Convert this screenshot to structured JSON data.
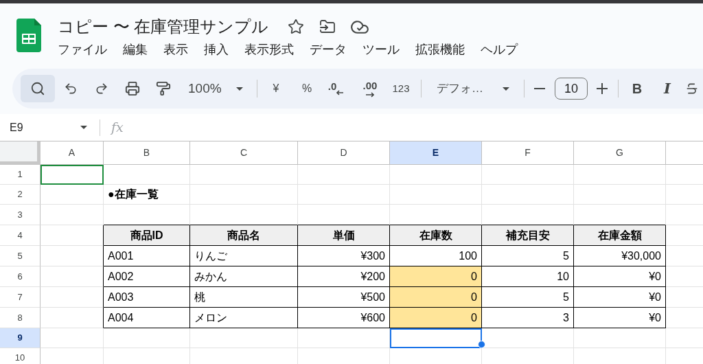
{
  "window": {
    "title": "コピー 〜 在庫管理サンプル"
  },
  "menu": [
    "ファイル",
    "編集",
    "表示",
    "挿入",
    "表示形式",
    "データ",
    "ツール",
    "拡張機能",
    "ヘルプ"
  ],
  "toolbar": {
    "search": {
      "selected": true
    },
    "zoom": "100%",
    "currency": "¥",
    "percent": "%",
    "decrease_decimal": ".0",
    "increase_decimal": ".00",
    "number_format": "123",
    "font": "デフォ…",
    "font_size": "10",
    "bold": "B",
    "italic": "I"
  },
  "formula_bar": {
    "name_box": "E9",
    "fx": "fx"
  },
  "sheet": {
    "columns": [
      {
        "label": "A",
        "selected": false
      },
      {
        "label": "B",
        "selected": false
      },
      {
        "label": "C",
        "selected": false
      },
      {
        "label": "D",
        "selected": false
      },
      {
        "label": "E",
        "selected": true
      },
      {
        "label": "F",
        "selected": false
      },
      {
        "label": "G",
        "selected": false
      }
    ],
    "rows": [
      {
        "label": "1",
        "selected": false,
        "cells": [
          {
            "kind": "cursor",
            "selected": false
          },
          {
            "kind": "empty",
            "selected": false
          },
          {
            "kind": "empty",
            "selected": false
          },
          {
            "kind": "empty",
            "selected": false
          },
          {
            "kind": "empty",
            "selected": false
          },
          {
            "kind": "empty",
            "selected": false
          },
          {
            "kind": "empty",
            "selected": false
          }
        ]
      },
      {
        "label": "2",
        "selected": false,
        "cells": [
          {
            "kind": "empty",
            "selected": false
          },
          {
            "kind": "title",
            "text": "●在庫一覧",
            "selected": false
          },
          {
            "kind": "empty",
            "selected": false
          },
          {
            "kind": "empty",
            "selected": false
          },
          {
            "kind": "empty",
            "selected": false
          },
          {
            "kind": "empty",
            "selected": false
          },
          {
            "kind": "empty",
            "selected": false
          }
        ]
      },
      {
        "label": "3",
        "selected": false,
        "cells": [
          {
            "kind": "empty",
            "selected": false
          },
          {
            "kind": "empty",
            "selected": false
          },
          {
            "kind": "empty",
            "selected": false
          },
          {
            "kind": "empty",
            "selected": false
          },
          {
            "kind": "empty",
            "selected": false
          },
          {
            "kind": "empty",
            "selected": false
          },
          {
            "kind": "empty",
            "selected": false
          }
        ]
      },
      {
        "label": "4",
        "selected": false,
        "cells": [
          {
            "kind": "empty",
            "selected": false
          },
          {
            "kind": "header",
            "text": "商品ID",
            "highlighted": false,
            "selected": false
          },
          {
            "kind": "header",
            "text": "商品名",
            "highlighted": false,
            "selected": false
          },
          {
            "kind": "header",
            "text": "単価",
            "highlighted": false,
            "selected": false
          },
          {
            "kind": "header",
            "text": "在庫数",
            "highlighted": false,
            "selected": false
          },
          {
            "kind": "header",
            "text": "補充目安",
            "highlighted": false,
            "selected": false
          },
          {
            "kind": "header",
            "text": "在庫金額",
            "highlighted": false,
            "selected": false
          }
        ]
      },
      {
        "label": "5",
        "selected": false,
        "cells": [
          {
            "kind": "empty",
            "selected": false
          },
          {
            "kind": "text",
            "text": "A001",
            "highlighted": false,
            "selected": false
          },
          {
            "kind": "text",
            "text": "りんご",
            "highlighted": false,
            "selected": false
          },
          {
            "kind": "number",
            "text": "¥300",
            "highlighted": false,
            "selected": false
          },
          {
            "kind": "number",
            "text": "100",
            "highlighted": false,
            "selected": false
          },
          {
            "kind": "number",
            "text": "5",
            "highlighted": false,
            "selected": false
          },
          {
            "kind": "number",
            "text": "¥30,000",
            "highlighted": false,
            "selected": false
          }
        ]
      },
      {
        "label": "6",
        "selected": false,
        "cells": [
          {
            "kind": "empty",
            "selected": false
          },
          {
            "kind": "text",
            "text": "A002",
            "highlighted": false,
            "selected": false
          },
          {
            "kind": "text",
            "text": "みかん",
            "highlighted": false,
            "selected": false
          },
          {
            "kind": "number",
            "text": "¥200",
            "highlighted": false,
            "selected": false
          },
          {
            "kind": "number",
            "text": "0",
            "highlighted": true,
            "selected": false
          },
          {
            "kind": "number",
            "text": "10",
            "highlighted": false,
            "selected": false
          },
          {
            "kind": "number",
            "text": "¥0",
            "highlighted": false,
            "selected": false
          }
        ]
      },
      {
        "label": "7",
        "selected": false,
        "cells": [
          {
            "kind": "empty",
            "selected": false
          },
          {
            "kind": "text",
            "text": "A003",
            "highlighted": false,
            "selected": false
          },
          {
            "kind": "text",
            "text": "桃",
            "highlighted": false,
            "selected": false
          },
          {
            "kind": "number",
            "text": "¥500",
            "highlighted": false,
            "selected": false
          },
          {
            "kind": "number",
            "text": "0",
            "highlighted": true,
            "selected": false
          },
          {
            "kind": "number",
            "text": "5",
            "highlighted": false,
            "selected": false
          },
          {
            "kind": "number",
            "text": "¥0",
            "highlighted": false,
            "selected": false
          }
        ]
      },
      {
        "label": "8",
        "selected": false,
        "cells": [
          {
            "kind": "empty",
            "selected": false
          },
          {
            "kind": "text",
            "text": "A004",
            "highlighted": false,
            "selected": false
          },
          {
            "kind": "text",
            "text": "メロン",
            "highlighted": false,
            "selected": false
          },
          {
            "kind": "number",
            "text": "¥600",
            "highlighted": false,
            "selected": false
          },
          {
            "kind": "number",
            "text": "0",
            "highlighted": true,
            "selected": false
          },
          {
            "kind": "number",
            "text": "3",
            "highlighted": false,
            "selected": false
          },
          {
            "kind": "number",
            "text": "¥0",
            "highlighted": false,
            "selected": false
          }
        ]
      },
      {
        "label": "9",
        "selected": true,
        "cells": [
          {
            "kind": "empty",
            "selected": false
          },
          {
            "kind": "empty",
            "selected": false
          },
          {
            "kind": "empty",
            "selected": false
          },
          {
            "kind": "empty",
            "selected": false
          },
          {
            "kind": "empty",
            "selected": true
          },
          {
            "kind": "empty",
            "selected": false
          },
          {
            "kind": "empty",
            "selected": false
          }
        ]
      },
      {
        "label": "10",
        "selected": false,
        "cells": [
          {
            "kind": "empty",
            "selected": false
          },
          {
            "kind": "empty",
            "selected": false
          },
          {
            "kind": "empty",
            "selected": false
          },
          {
            "kind": "empty",
            "selected": false
          },
          {
            "kind": "empty",
            "selected": false
          },
          {
            "kind": "empty",
            "selected": false
          },
          {
            "kind": "empty",
            "selected": false
          }
        ]
      }
    ]
  }
}
